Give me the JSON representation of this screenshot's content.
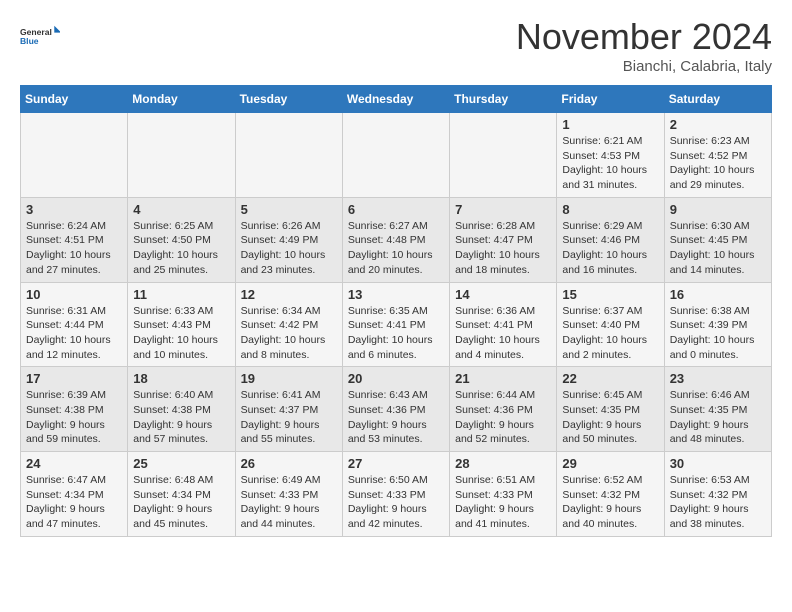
{
  "header": {
    "logo_general": "General",
    "logo_blue": "Blue",
    "month_title": "November 2024",
    "location": "Bianchi, Calabria, Italy"
  },
  "weekdays": [
    "Sunday",
    "Monday",
    "Tuesday",
    "Wednesday",
    "Thursday",
    "Friday",
    "Saturday"
  ],
  "weeks": [
    [
      {
        "day": "",
        "info": ""
      },
      {
        "day": "",
        "info": ""
      },
      {
        "day": "",
        "info": ""
      },
      {
        "day": "",
        "info": ""
      },
      {
        "day": "",
        "info": ""
      },
      {
        "day": "1",
        "info": "Sunrise: 6:21 AM\nSunset: 4:53 PM\nDaylight: 10 hours\nand 31 minutes."
      },
      {
        "day": "2",
        "info": "Sunrise: 6:23 AM\nSunset: 4:52 PM\nDaylight: 10 hours\nand 29 minutes."
      }
    ],
    [
      {
        "day": "3",
        "info": "Sunrise: 6:24 AM\nSunset: 4:51 PM\nDaylight: 10 hours\nand 27 minutes."
      },
      {
        "day": "4",
        "info": "Sunrise: 6:25 AM\nSunset: 4:50 PM\nDaylight: 10 hours\nand 25 minutes."
      },
      {
        "day": "5",
        "info": "Sunrise: 6:26 AM\nSunset: 4:49 PM\nDaylight: 10 hours\nand 23 minutes."
      },
      {
        "day": "6",
        "info": "Sunrise: 6:27 AM\nSunset: 4:48 PM\nDaylight: 10 hours\nand 20 minutes."
      },
      {
        "day": "7",
        "info": "Sunrise: 6:28 AM\nSunset: 4:47 PM\nDaylight: 10 hours\nand 18 minutes."
      },
      {
        "day": "8",
        "info": "Sunrise: 6:29 AM\nSunset: 4:46 PM\nDaylight: 10 hours\nand 16 minutes."
      },
      {
        "day": "9",
        "info": "Sunrise: 6:30 AM\nSunset: 4:45 PM\nDaylight: 10 hours\nand 14 minutes."
      }
    ],
    [
      {
        "day": "10",
        "info": "Sunrise: 6:31 AM\nSunset: 4:44 PM\nDaylight: 10 hours\nand 12 minutes."
      },
      {
        "day": "11",
        "info": "Sunrise: 6:33 AM\nSunset: 4:43 PM\nDaylight: 10 hours\nand 10 minutes."
      },
      {
        "day": "12",
        "info": "Sunrise: 6:34 AM\nSunset: 4:42 PM\nDaylight: 10 hours\nand 8 minutes."
      },
      {
        "day": "13",
        "info": "Sunrise: 6:35 AM\nSunset: 4:41 PM\nDaylight: 10 hours\nand 6 minutes."
      },
      {
        "day": "14",
        "info": "Sunrise: 6:36 AM\nSunset: 4:41 PM\nDaylight: 10 hours\nand 4 minutes."
      },
      {
        "day": "15",
        "info": "Sunrise: 6:37 AM\nSunset: 4:40 PM\nDaylight: 10 hours\nand 2 minutes."
      },
      {
        "day": "16",
        "info": "Sunrise: 6:38 AM\nSunset: 4:39 PM\nDaylight: 10 hours\nand 0 minutes."
      }
    ],
    [
      {
        "day": "17",
        "info": "Sunrise: 6:39 AM\nSunset: 4:38 PM\nDaylight: 9 hours\nand 59 minutes."
      },
      {
        "day": "18",
        "info": "Sunrise: 6:40 AM\nSunset: 4:38 PM\nDaylight: 9 hours\nand 57 minutes."
      },
      {
        "day": "19",
        "info": "Sunrise: 6:41 AM\nSunset: 4:37 PM\nDaylight: 9 hours\nand 55 minutes."
      },
      {
        "day": "20",
        "info": "Sunrise: 6:43 AM\nSunset: 4:36 PM\nDaylight: 9 hours\nand 53 minutes."
      },
      {
        "day": "21",
        "info": "Sunrise: 6:44 AM\nSunset: 4:36 PM\nDaylight: 9 hours\nand 52 minutes."
      },
      {
        "day": "22",
        "info": "Sunrise: 6:45 AM\nSunset: 4:35 PM\nDaylight: 9 hours\nand 50 minutes."
      },
      {
        "day": "23",
        "info": "Sunrise: 6:46 AM\nSunset: 4:35 PM\nDaylight: 9 hours\nand 48 minutes."
      }
    ],
    [
      {
        "day": "24",
        "info": "Sunrise: 6:47 AM\nSunset: 4:34 PM\nDaylight: 9 hours\nand 47 minutes."
      },
      {
        "day": "25",
        "info": "Sunrise: 6:48 AM\nSunset: 4:34 PM\nDaylight: 9 hours\nand 45 minutes."
      },
      {
        "day": "26",
        "info": "Sunrise: 6:49 AM\nSunset: 4:33 PM\nDaylight: 9 hours\nand 44 minutes."
      },
      {
        "day": "27",
        "info": "Sunrise: 6:50 AM\nSunset: 4:33 PM\nDaylight: 9 hours\nand 42 minutes."
      },
      {
        "day": "28",
        "info": "Sunrise: 6:51 AM\nSunset: 4:33 PM\nDaylight: 9 hours\nand 41 minutes."
      },
      {
        "day": "29",
        "info": "Sunrise: 6:52 AM\nSunset: 4:32 PM\nDaylight: 9 hours\nand 40 minutes."
      },
      {
        "day": "30",
        "info": "Sunrise: 6:53 AM\nSunset: 4:32 PM\nDaylight: 9 hours\nand 38 minutes."
      }
    ]
  ]
}
